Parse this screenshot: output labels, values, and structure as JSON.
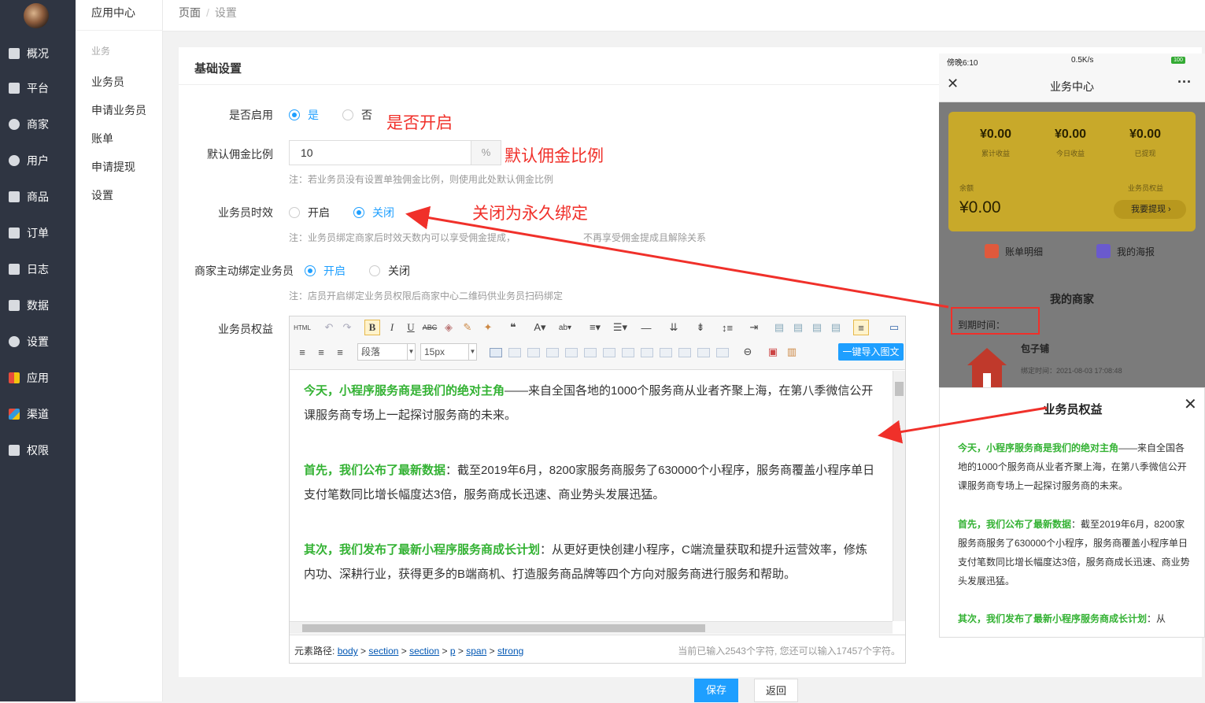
{
  "sidebar": {
    "items": [
      {
        "label": "概况",
        "icon": "chart-icon"
      },
      {
        "label": "平台",
        "icon": "monitor-icon"
      },
      {
        "label": "商家",
        "icon": "store-icon"
      },
      {
        "label": "用户",
        "icon": "user-icon"
      },
      {
        "label": "商品",
        "icon": "goods-icon"
      },
      {
        "label": "订单",
        "icon": "order-icon"
      },
      {
        "label": "日志",
        "icon": "log-icon"
      },
      {
        "label": "数据",
        "icon": "bar-chart-icon"
      },
      {
        "label": "设置",
        "icon": "gear-icon"
      },
      {
        "label": "应用",
        "icon": "apps-icon"
      },
      {
        "label": "渠道",
        "icon": "cube-icon"
      },
      {
        "label": "权限",
        "icon": "lock-icon"
      }
    ]
  },
  "submenu": {
    "title": "应用中心",
    "group": "业务",
    "items": [
      "业务员",
      "申请业务员",
      "账单",
      "申请提现",
      "设置"
    ]
  },
  "breadcrumb": {
    "root": "页面",
    "sep": "/",
    "current": "设置"
  },
  "card": {
    "title": "基础设置"
  },
  "form": {
    "enable": {
      "label": "是否启用",
      "yes": "是",
      "no": "否",
      "selected": "是"
    },
    "commission": {
      "label": "默认佣金比例",
      "value": "10",
      "unit": "%",
      "note": "注：若业务员没有设置单独佣金比例，则使用此处默认佣金比例"
    },
    "validity": {
      "label": "业务员时效",
      "on": "开启",
      "off": "关闭",
      "selected": "关闭",
      "note": "注：业务员绑定商家后时效天数内可以享受佣金提成，",
      "note_tail": "不再享受佣金提成且解除关系"
    },
    "merchant_bind": {
      "label": "商家主动绑定业务员",
      "on": "开启",
      "off": "关闭",
      "selected": "开启",
      "note": "注：店员开启绑定业务员权限后商家中心二维码供业务员扫码绑定"
    },
    "rights": {
      "label": "业务员权益"
    }
  },
  "annotations": {
    "enable": "是否开启",
    "commission": "默认佣金比例",
    "validity": "关闭为永久绑定"
  },
  "editor": {
    "html_btn": "HTML",
    "paragraph_select": "段落",
    "fontsize_select": "15px",
    "import_button": "一键导入图文",
    "content": [
      {
        "lead": "今天，小程序服务商是我们的绝对主角",
        "text": "——来自全国各地的1000个服务商从业者齐聚上海，在第八季微信公开课服务商专场上一起探讨服务商的未来。"
      },
      {
        "lead": "首先，我们公布了最新数据",
        "text": "：截至2019年6月，8200家服务商服务了630000个小程序，服务商覆盖小程序单日支付笔数同比增长幅度达3倍，服务商成长迅速、商业势头发展迅猛。"
      },
      {
        "lead": "其次，我们发布了最新小程序服务商成长计划",
        "text": "：从更好更快创建小程序，C端流量获取和提升运营效率，修炼内功、深耕行业，获得更多的B端商机、打造服务商品牌等四个方向对服务商进行服务和帮助。"
      }
    ],
    "path_label": "元素路径:",
    "path": [
      "body",
      "section",
      "section",
      "p",
      "span",
      "strong"
    ],
    "count_text": "当前已输入2543个字符, 您还可以输入17457个字符。"
  },
  "buttons": {
    "save": "保存",
    "back": "返回"
  },
  "phone": {
    "time": "傍晚6:10",
    "net": "0.5K/s",
    "battery": "100",
    "title": "业务中心",
    "stats": [
      {
        "value": "¥0.00",
        "label": "累计收益"
      },
      {
        "value": "¥0.00",
        "label": "今日收益"
      },
      {
        "value": "¥0.00",
        "label": "已提现"
      }
    ],
    "balance_label": "余额",
    "balance": "¥0.00",
    "rights_label": "业务员权益",
    "withdraw": "我要提现",
    "bill": "账单明细",
    "poster": "我的海报",
    "merchant_title": "我的商家",
    "expire": "到期时间：",
    "shop_name": "包子铺",
    "shop_time": "绑定时间：2021-08-03 17:08:48"
  },
  "popup": {
    "title": "业务员权益",
    "content": [
      {
        "lead": "今天，小程序服务商是我们的绝对主角",
        "text": "——来自全国各地的1000个服务商从业者齐聚上海，在第八季微信公开课服务商专场上一起探讨服务商的未来。"
      },
      {
        "lead": "首先，我们公布了最新数据",
        "text": "：截至2019年6月，8200家服务商服务了630000个小程序，服务商覆盖小程序单日支付笔数同比增长幅度达3倍，服务商成长迅速、商业势头发展迅猛。"
      },
      {
        "lead": "其次，我们发布了最新小程序服务商成长计划",
        "text": "：从"
      }
    ]
  },
  "colors": {
    "accent": "#1e9fff",
    "annotation": "#f0302a",
    "highlight": "#33b233",
    "sidebar": "#2f3542"
  }
}
